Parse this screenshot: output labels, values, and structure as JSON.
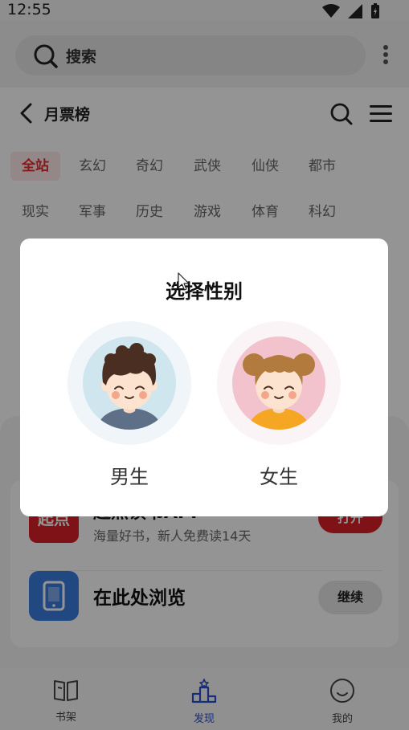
{
  "status_bar": {
    "time": "12:55"
  },
  "search": {
    "placeholder": "搜索"
  },
  "page": {
    "title": "月票榜",
    "categories_row1": [
      "全站",
      "玄幻",
      "奇幻",
      "武侠",
      "仙侠",
      "都市"
    ],
    "categories_row2": [
      "现实",
      "军事",
      "历史",
      "游戏",
      "体育",
      "科幻"
    ],
    "active_category": "全站"
  },
  "sheet": {
    "app1": {
      "logo_text": "起点",
      "title": "起点读书APP",
      "subtitle": "海量好书，新人免费读14天",
      "button": "打开"
    },
    "app2": {
      "title": "在此处浏览",
      "button": "继续"
    }
  },
  "tabs": [
    {
      "label": "书架",
      "icon": "book-icon",
      "active": false
    },
    {
      "label": "发现",
      "icon": "podium-icon",
      "active": true
    },
    {
      "label": "我的",
      "icon": "smile-icon",
      "active": false
    }
  ],
  "dialog": {
    "title": "选择性别",
    "options": [
      {
        "label": "男生",
        "icon": "boy-avatar-icon"
      },
      {
        "label": "女生",
        "icon": "girl-avatar-icon"
      }
    ]
  },
  "colors": {
    "accent_red": "#d91f26",
    "tab_active": "#2a4fcf",
    "app_blue": "#3b7de0"
  }
}
